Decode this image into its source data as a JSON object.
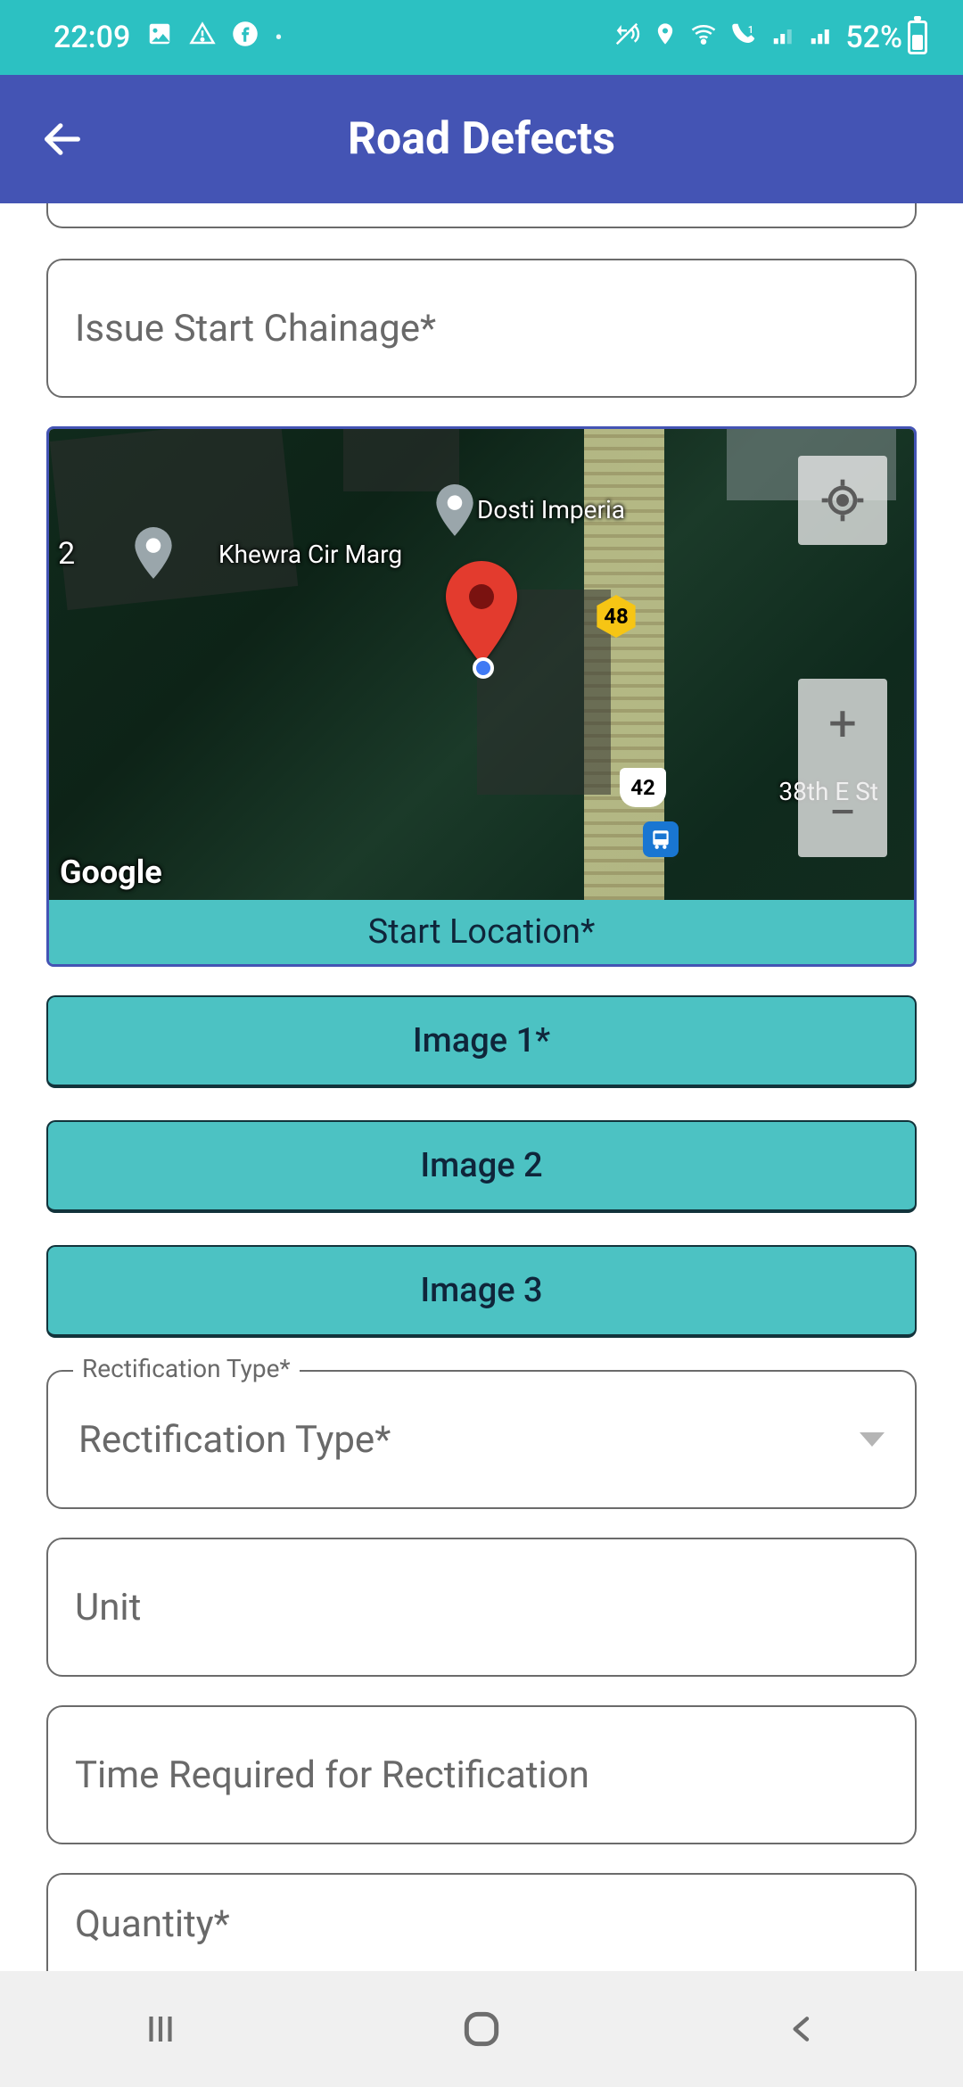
{
  "status": {
    "time": "22:09",
    "left_icons": [
      "image-icon",
      "warning-triangle-icon",
      "facebook-icon",
      "dot"
    ],
    "right_icons": [
      "vibrate-off-icon",
      "location-icon",
      "wifi-icon",
      "call-wifi-icon",
      "signal-1-icon",
      "signal-2-icon"
    ],
    "battery_pct": "52%"
  },
  "appbar": {
    "title": "Road Defects"
  },
  "form": {
    "issue_start_chainage_ph": "Issue Start Chainage*",
    "unit_ph": "Unit",
    "time_required_ph": "Time Required for Rectification",
    "quantity_ph": "Quantity*"
  },
  "map": {
    "caption": "Start Location*",
    "attribution": "Google",
    "labels": {
      "khewra": "Khewra Cir Marg",
      "dosti": "Dosti Imperia",
      "street38": "38th E St",
      "edge_num": "2"
    },
    "shields": {
      "yellow": "48",
      "white": "42"
    }
  },
  "image_buttons": [
    "Image 1*",
    "Image 2",
    "Image 3"
  ],
  "rectification": {
    "legend": "Rectification Type*",
    "placeholder": "Rectification Type*"
  }
}
